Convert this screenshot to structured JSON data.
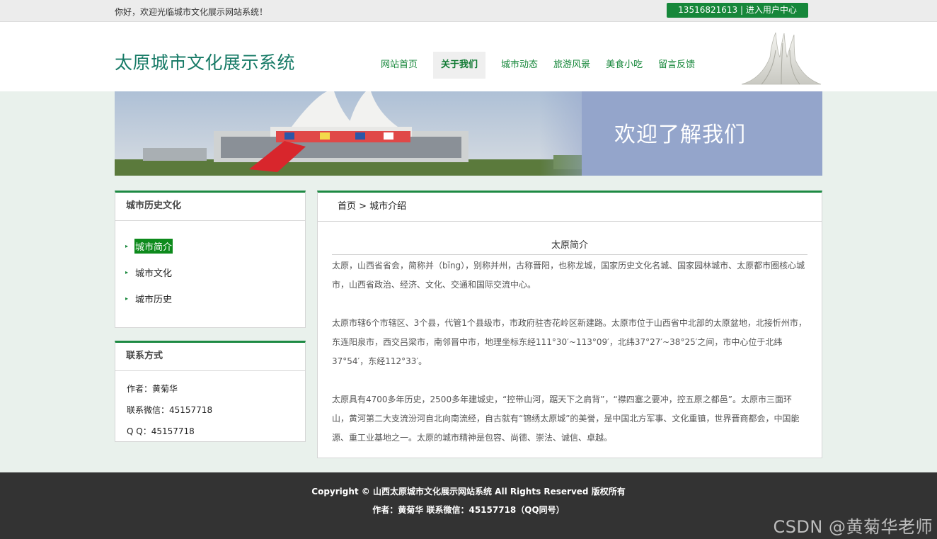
{
  "topbar": {
    "welcome": "你好，欢迎光临城市文化展示网站系统！",
    "user_center": "13516821613 | 进入用户中心"
  },
  "header": {
    "site_title": "太原城市文化展示系统",
    "nav": [
      {
        "label": "网站首页"
      },
      {
        "label": "关于我们"
      },
      {
        "label": "城市动态"
      },
      {
        "label": "旅游风景"
      },
      {
        "label": "美食小吃"
      },
      {
        "label": "留言反馈"
      }
    ],
    "active_nav": "关于我们"
  },
  "banner": {
    "text": "欢迎了解我们"
  },
  "sidebar": {
    "history": {
      "title": "城市历史文化",
      "items": [
        {
          "label": "城市简介"
        },
        {
          "label": "城市文化"
        },
        {
          "label": "城市历史"
        }
      ],
      "active_item": "城市简介"
    },
    "contact": {
      "title": "联系方式",
      "rows": [
        "作者：黄菊华",
        "联系微信：45157718",
        "Q Q：45157718"
      ]
    }
  },
  "main": {
    "breadcrumb": "首页 > 城市介绍",
    "article_title": "太原简介",
    "paragraphs": [
      "太原，山西省省会，简称并（bīng），别称并州，古称晋阳，也称龙城，国家历史文化名城、国家园林城市、太原都市圈核心城市，山西省政治、经济、文化、交通和国际交流中心。",
      "太原市辖6个市辖区、3个县，代管1个县级市，市政府驻杏花岭区新建路。太原市位于山西省中北部的太原盆地，北接忻州市，东连阳泉市，西交吕梁市，南邻晋中市，地理坐标东经111°30′~113°09′，北纬37°27′~38°25′之间，市中心位于北纬37°54′，东经112°33′。",
      " 太原具有4700多年历史，2500多年建城史，“控带山河，踞天下之肩背”，“襟四塞之要冲，控五原之都邑”。太原市三面环山，黄河第二大支流汾河自北向南流经，自古就有“锦绣太原城”的美誉，是中国北方军事、文化重镇，世界晋商都会，中国能源、重工业基地之一。太原的城市精神是包容、尚德、崇法、诚信、卓越。"
    ]
  },
  "footer": {
    "line1": "Copyright © 山西太原城市文化展示网站系统      All Rights Reserved 版权所有",
    "line2": "作者：黄菊华      联系微信：45157718（QQ同号）"
  },
  "watermark": "CSDN @黄菊华老师",
  "colors": {
    "brand_green": "#16873a",
    "title_teal": "#167a66",
    "page_bg": "#e9f1ec",
    "footer_bg": "#333333"
  }
}
